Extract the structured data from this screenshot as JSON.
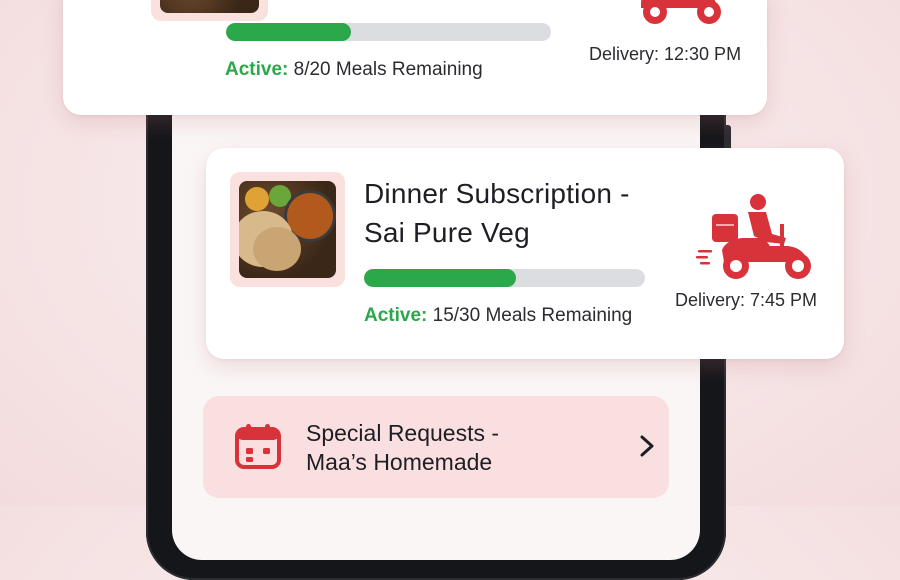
{
  "subscriptions": [
    {
      "status_label": "Active:",
      "remaining_text": "8/20 Meals Remaining",
      "progress": 0.385,
      "delivery": "Delivery: 12:30 PM"
    },
    {
      "title_line1": "Dinner Subscription -",
      "title_line2": "Sai Pure Veg",
      "status_label": "Active:",
      "remaining_text": "15/30 Meals Remaining",
      "progress": 0.54,
      "delivery": "Delivery: 7:45 PM"
    }
  ],
  "special_request": {
    "line1": "Special Requests -",
    "line2": "Maa’s Homemade"
  },
  "colors": {
    "accent_green": "#2aa84a",
    "brand_red": "#d8323a",
    "card_tint": "#f9dfe0"
  },
  "icons": {
    "delivery": "delivery-scooter-icon",
    "calendar": "calendar-icon",
    "chevron": "chevron-right-icon"
  }
}
